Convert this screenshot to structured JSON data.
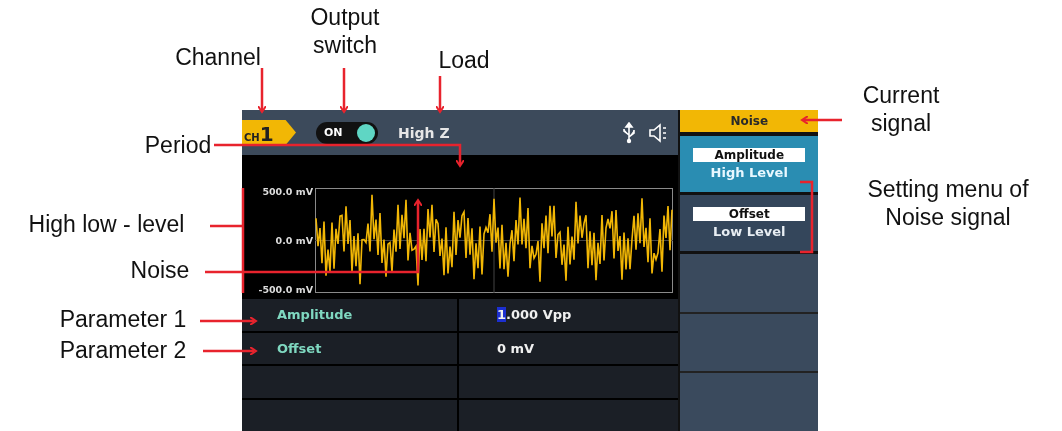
{
  "annotations": [
    {
      "text": "Channel"
    },
    {
      "text": "Output switch"
    },
    {
      "text": "Load"
    },
    {
      "text": "Current signal"
    },
    {
      "text": "Period"
    },
    {
      "text": "High low - level"
    },
    {
      "text": "Noise"
    },
    {
      "text": "Setting menu of Noise signal"
    },
    {
      "text": "Parameter 1"
    },
    {
      "text": "Parameter 2"
    }
  ],
  "status_bar": {
    "channel_prefix": "CH",
    "channel_number": "1",
    "output": {
      "label": "ON",
      "on": true
    },
    "load": "High Z"
  },
  "waveform": {
    "axis_labels": [
      "500.0 mV",
      "0.0 mV",
      "-500.0 mV"
    ]
  },
  "parameters": [
    {
      "name": "Amplitude",
      "cursor": "1",
      "value": ".000 Vpp"
    },
    {
      "name": "Offset",
      "value": "0 mV"
    }
  ],
  "menu": {
    "title": "Noise",
    "items": [
      {
        "label": "Amplitude",
        "sublabel": "High Level",
        "selected": true
      },
      {
        "label": "Offset",
        "sublabel": "Low Level",
        "selected": false
      }
    ]
  }
}
